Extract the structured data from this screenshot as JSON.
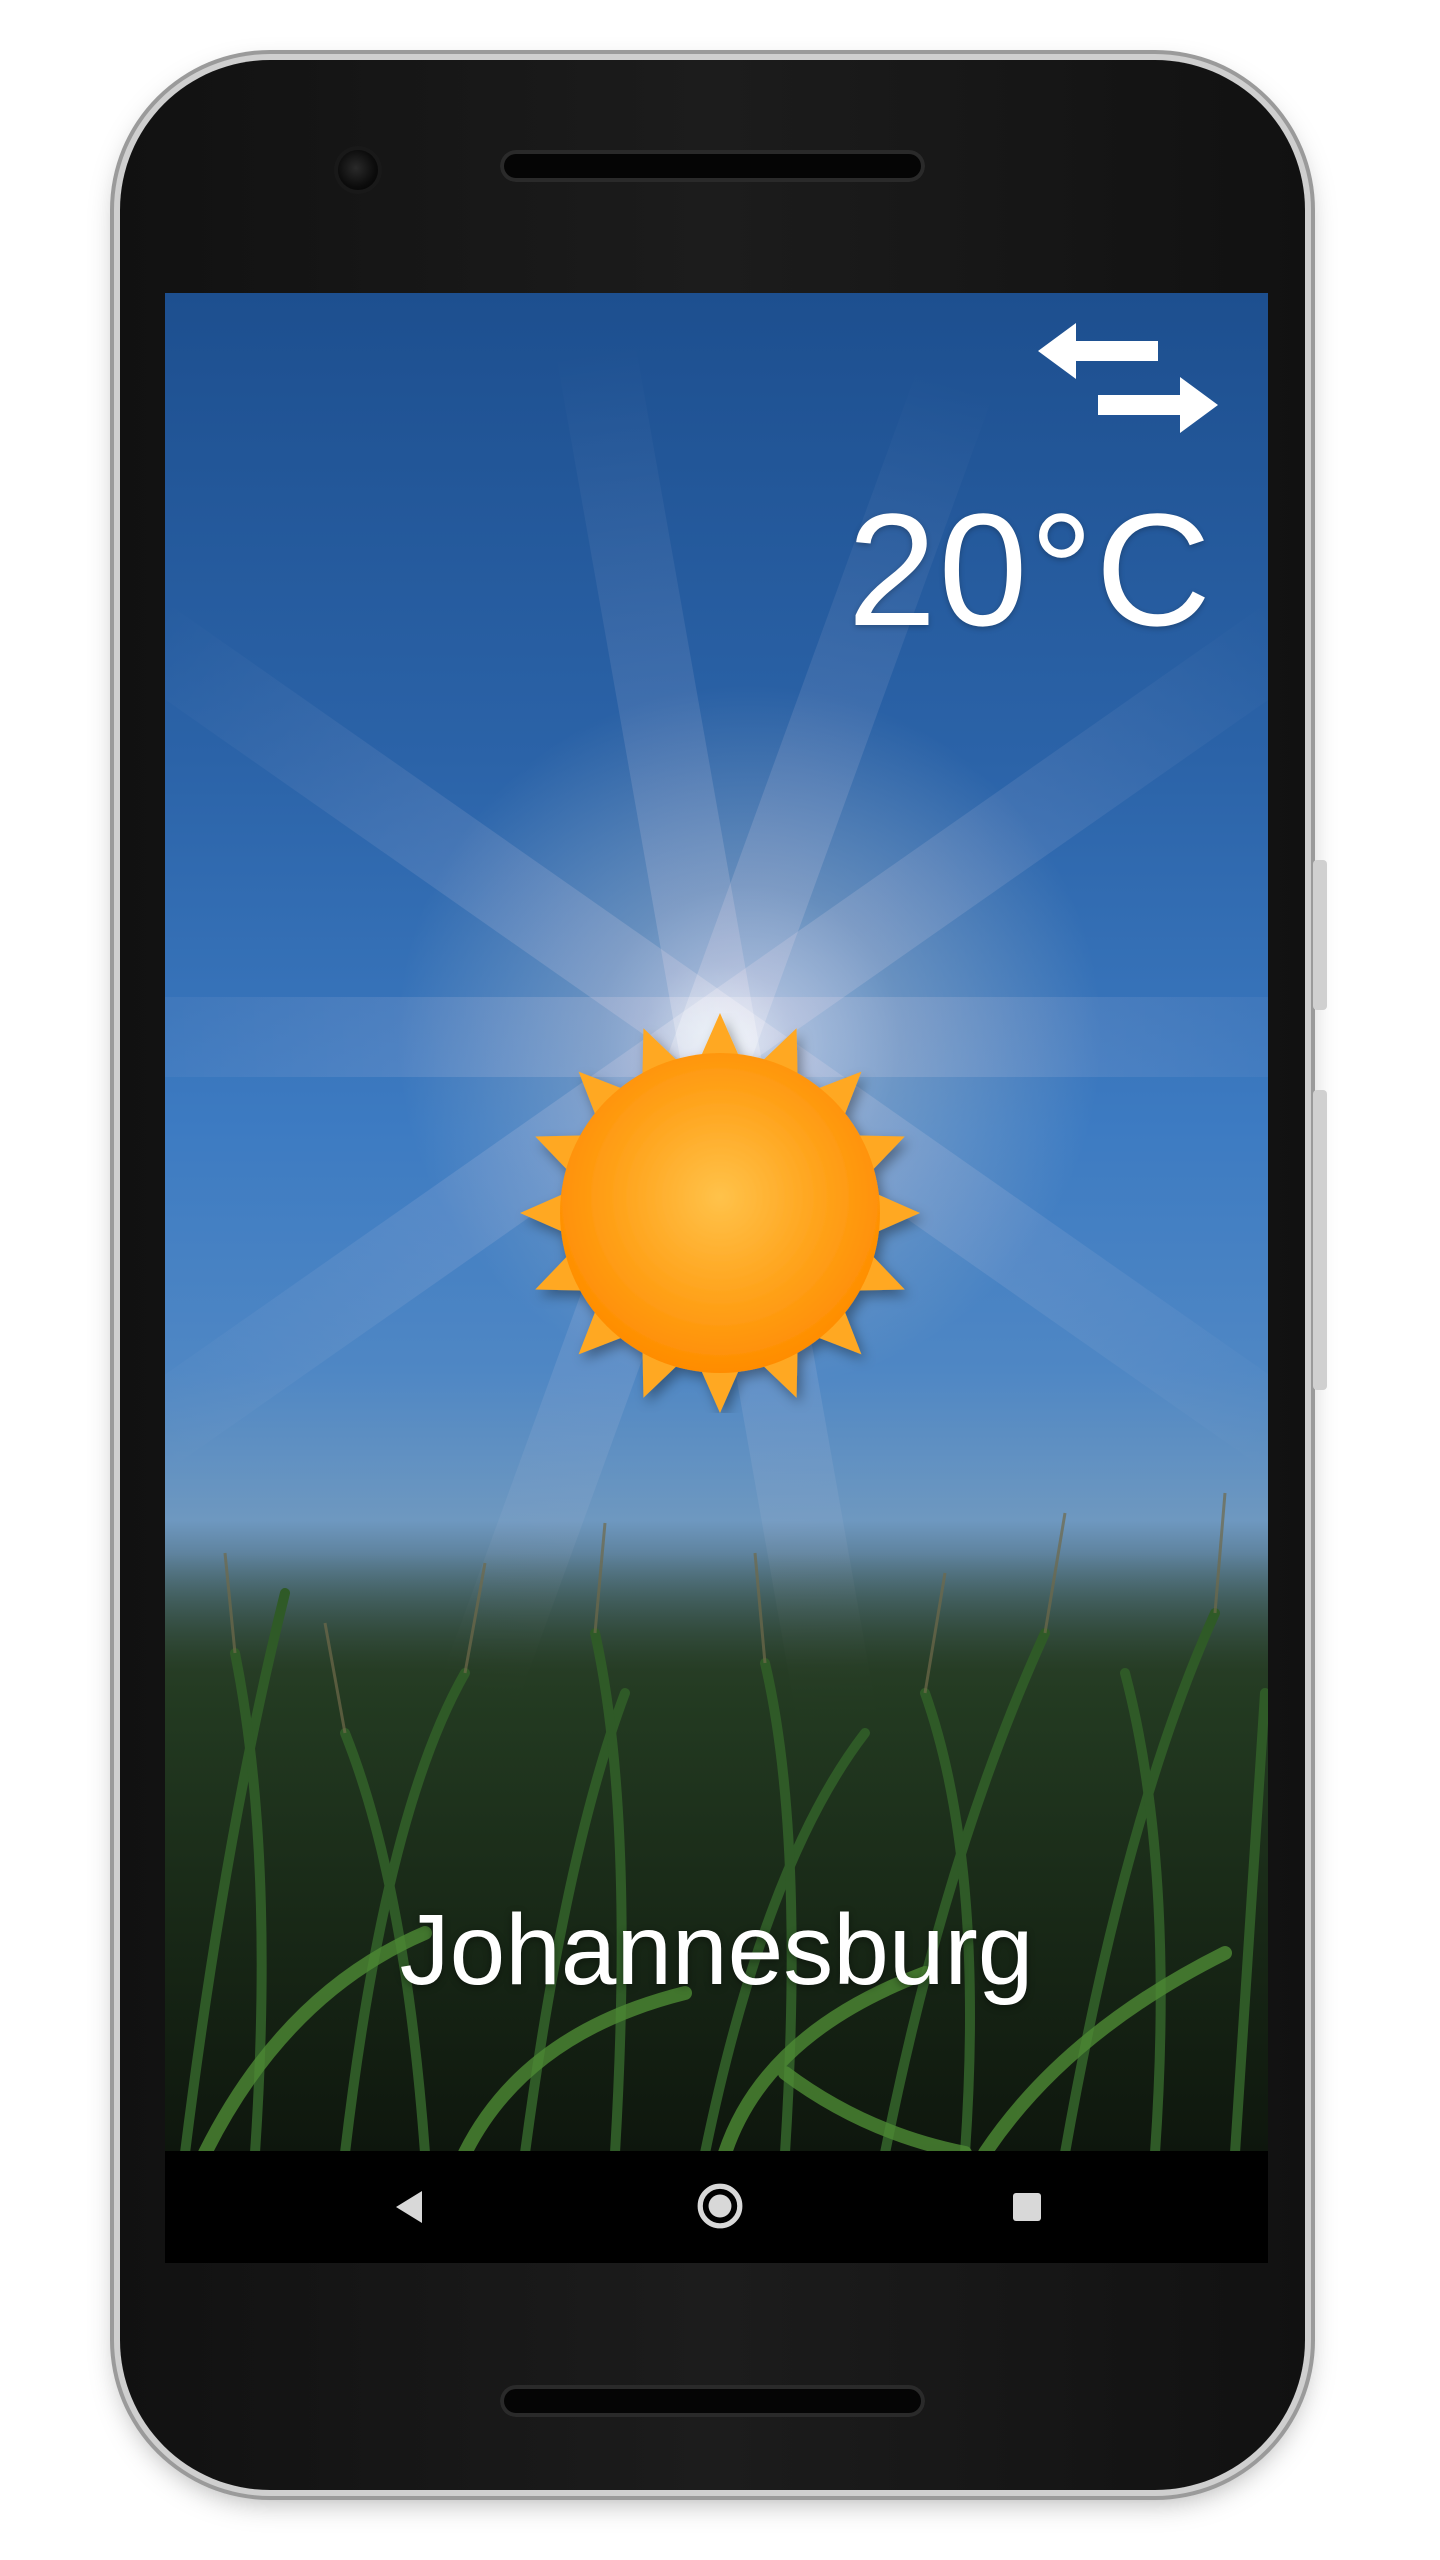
{
  "weather": {
    "temperature": "20°C",
    "city": "Johannesburg",
    "condition_icon": "sun-icon",
    "toggle_icon": "swap-arrows-icon"
  },
  "navigation": {
    "back_icon": "back-triangle-icon",
    "home_icon": "home-circle-icon",
    "recents_icon": "recents-square-icon"
  },
  "colors": {
    "sky_top": "#1d4f8f",
    "sky_mid": "#3d7bc2",
    "sun_orange": "#ff9a0c",
    "sun_light": "#ffc24a",
    "grass_dark": "#172515",
    "text": "#ffffff",
    "navbar": "#000000"
  }
}
